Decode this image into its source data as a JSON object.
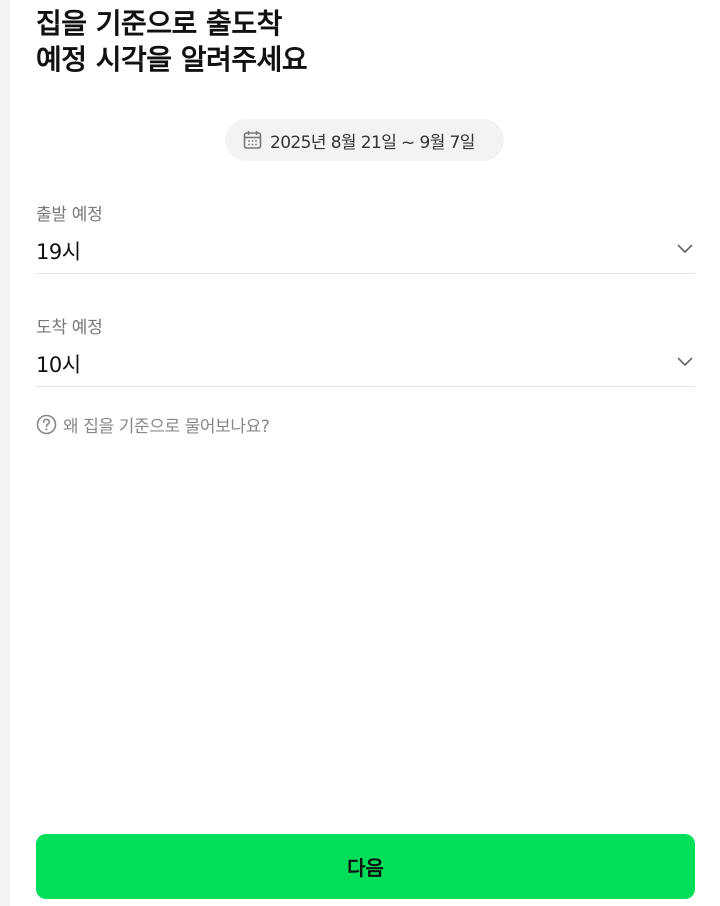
{
  "header": {
    "title_line1": "집을 기준으로 출도착",
    "title_line2": "예정 시각을 알려주세요"
  },
  "date_range": {
    "icon": "calendar-icon",
    "label": "2025년 8월 21일 ~ 9월 7일"
  },
  "departure": {
    "label": "출발 예정",
    "value": "19시",
    "icon": "chevron-down-icon"
  },
  "arrival": {
    "label": "도착 예정",
    "value": "10시",
    "icon": "chevron-down-icon"
  },
  "help": {
    "icon": "question-circle-icon",
    "text": "왜 집을 기준으로 물어보나요?"
  },
  "footer": {
    "next_label": "다음"
  },
  "colors": {
    "accent": "#00de5a",
    "chip_background": "#f2f3f5",
    "divider": "#e2e4e8",
    "muted_text": "#888888"
  }
}
